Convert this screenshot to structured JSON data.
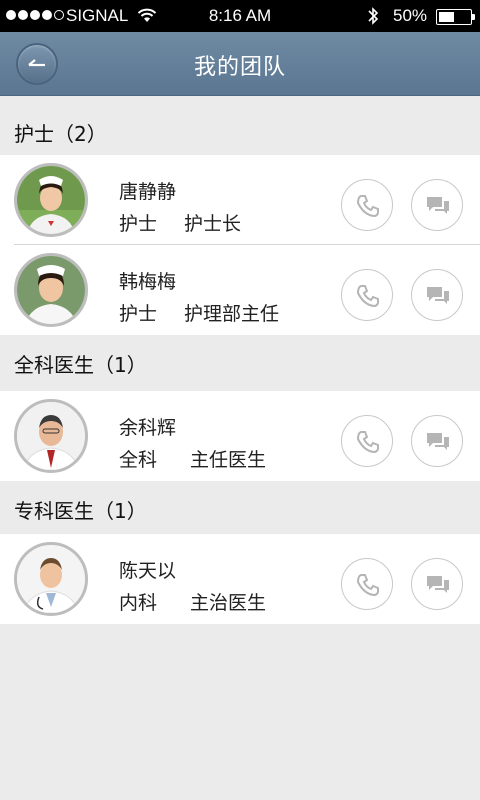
{
  "status_bar": {
    "carrier": "SIGNAL",
    "time": "8:16 AM",
    "battery_percent": "50%",
    "battery_level": 0.5,
    "signal_bars_filled": 4,
    "signal_bars_total": 5
  },
  "nav": {
    "title": "我的团队",
    "back_icon": "back-arrow-icon"
  },
  "sections": [
    {
      "header": "护士（2）",
      "members": [
        {
          "name": "唐静静",
          "dept": "护士",
          "title": "护士长"
        },
        {
          "name": "韩梅梅",
          "dept": "护士",
          "title": "护理部主任"
        }
      ]
    },
    {
      "header": "全科医生（1）",
      "members": [
        {
          "name": "余科辉",
          "dept": "全科",
          "title": "主任医生"
        }
      ]
    },
    {
      "header": "专科医生（1）",
      "members": [
        {
          "name": "陈天以",
          "dept": "内科",
          "title": "主治医生"
        }
      ]
    }
  ],
  "icons": {
    "call": "phone-icon",
    "message": "chat-bubble-icon"
  },
  "colors": {
    "nav_bar": "#6380 9b",
    "background": "#ebebeb",
    "icon_gray": "#b5b5b5"
  }
}
